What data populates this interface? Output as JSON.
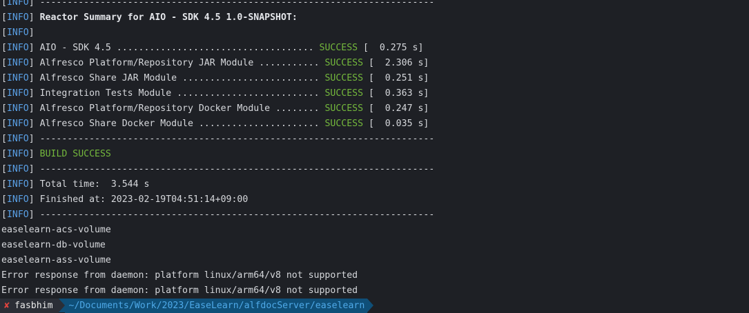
{
  "tag_open": "[",
  "tag_word": "INFO",
  "tag_close": "]",
  "lines": [
    {
      "rest": " ------------------------------------------------------------------------"
    },
    {
      "rest": " Reactor Summary for AIO - SDK 4.5 1.0-SNAPSHOT:"
    },
    {
      "rest": ""
    },
    {
      "pre": " AIO - SDK 4.5 .................................... ",
      "status": "SUCCESS",
      "post": " [  0.275 s]"
    },
    {
      "pre": " Alfresco Platform/Repository JAR Module ........... ",
      "status": "SUCCESS",
      "post": " [  2.306 s]"
    },
    {
      "pre": " Alfresco Share JAR Module ......................... ",
      "status": "SUCCESS",
      "post": " [  0.251 s]"
    },
    {
      "pre": " Integration Tests Module .......................... ",
      "status": "SUCCESS",
      "post": " [  0.363 s]"
    },
    {
      "pre": " Alfresco Platform/Repository Docker Module ........ ",
      "status": "SUCCESS",
      "post": " [  0.247 s]"
    },
    {
      "pre": " Alfresco Share Docker Module ...................... ",
      "status": "SUCCESS",
      "post": " [  0.035 s]"
    },
    {
      "rest": " ------------------------------------------------------------------------"
    },
    {
      "build": "BUILD SUCCESS"
    },
    {
      "rest": " ------------------------------------------------------------------------"
    },
    {
      "rest": " Total time:  3.544 s"
    },
    {
      "rest": " Finished at: 2023-02-19T04:51:14+09:00"
    },
    {
      "rest": " ------------------------------------------------------------------------"
    }
  ],
  "plain": [
    "easelearn-acs-volume",
    "easelearn-db-volume",
    "easelearn-ass-volume",
    "Error response from daemon: platform linux/arm64/v8 not supported",
    "Error response from daemon: platform linux/arm64/v8 not supported"
  ],
  "prompt": {
    "status_icon": "x-icon",
    "status_glyph": "✘",
    "user": "fasbhim",
    "path": "~/Documents/Work/2023/EaseLearn/alfdocServer/easelearn",
    "colors": {
      "background": "#1e2025",
      "info": "#5aa0e6",
      "success": "#74b83c",
      "error_icon": "#e0443e",
      "path_bg": "#0f4f78",
      "path_fg": "#4ea9e8"
    }
  }
}
